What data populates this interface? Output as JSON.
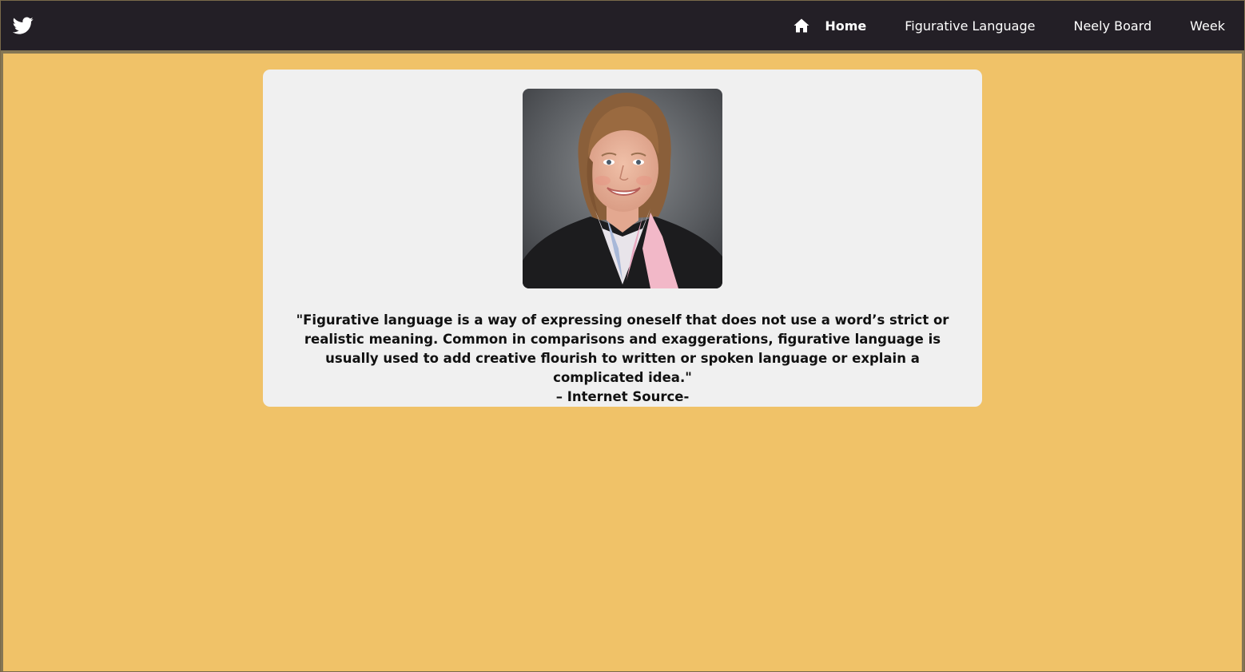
{
  "navbar": {
    "brand_icon": "twitter-bird-icon",
    "background": "#231f26",
    "items": [
      {
        "label": "Home",
        "icon": "home-icon",
        "active": true
      },
      {
        "label": "Figurative Language"
      },
      {
        "label": "Neely Board"
      },
      {
        "label": "Week"
      }
    ]
  },
  "page": {
    "background": "#f0c268",
    "card_background": "#f0f0f0"
  },
  "card": {
    "photo_alt": "teacher-portrait-photo",
    "quote_text": "\"Figurative language is a way of expressing oneself that does not use a word’s strict or realistic meaning. Common in comparisons and exaggerations, figurative language is usually used to add creative flourish to written or spoken language or explain a complicated idea.\"",
    "quote_source": "– Internet Source-"
  }
}
